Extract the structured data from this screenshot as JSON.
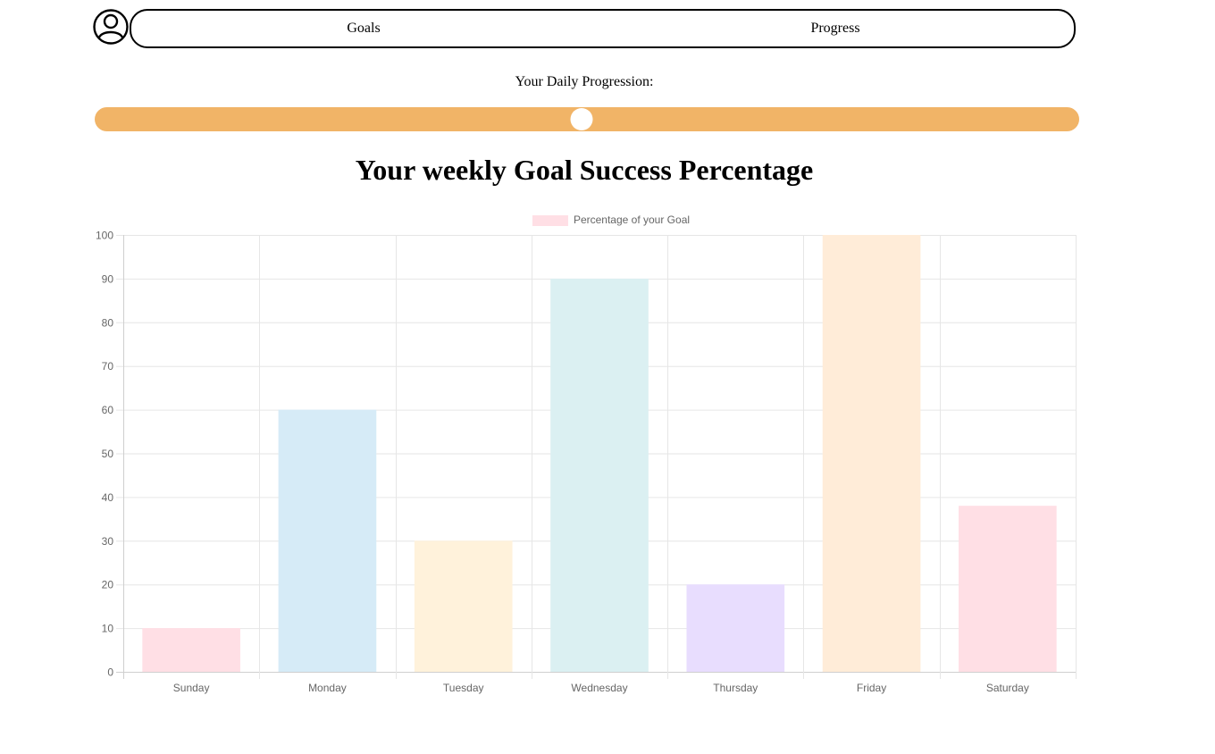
{
  "nav": {
    "goals_label": "Goals",
    "progress_label": "Progress",
    "avatar_icon": "user-circle-icon"
  },
  "progression": {
    "label": "Your Daily Progression:",
    "value_percent": 49.5,
    "color": "#f1b467"
  },
  "chart_title": "Your weekly Goal Success Percentage",
  "chart_data": {
    "type": "bar",
    "title": "Your weekly Goal Success Percentage",
    "legend": "Percentage of your  Goal",
    "legend_position": "top-center",
    "legend_color": "#ffdfe5",
    "categories": [
      "Sunday",
      "Monday",
      "Tuesday",
      "Wednesday",
      "Thursday",
      "Friday",
      "Saturday"
    ],
    "series": [
      {
        "name": "Percentage of your  Goal",
        "values": [
          10,
          60,
          30,
          90,
          20,
          100,
          38
        ]
      }
    ],
    "bar_colors": [
      "#ffdfe5",
      "#d6ebf7",
      "#fff2db",
      "#dbf0f2",
      "#e8ddfe",
      "#ffecd8",
      "#ffdfe5"
    ],
    "ylim": [
      0,
      100
    ],
    "yticks": [
      0,
      10,
      20,
      30,
      40,
      50,
      60,
      70,
      80,
      90,
      100
    ],
    "grid": true,
    "xlabel": "",
    "ylabel": ""
  }
}
